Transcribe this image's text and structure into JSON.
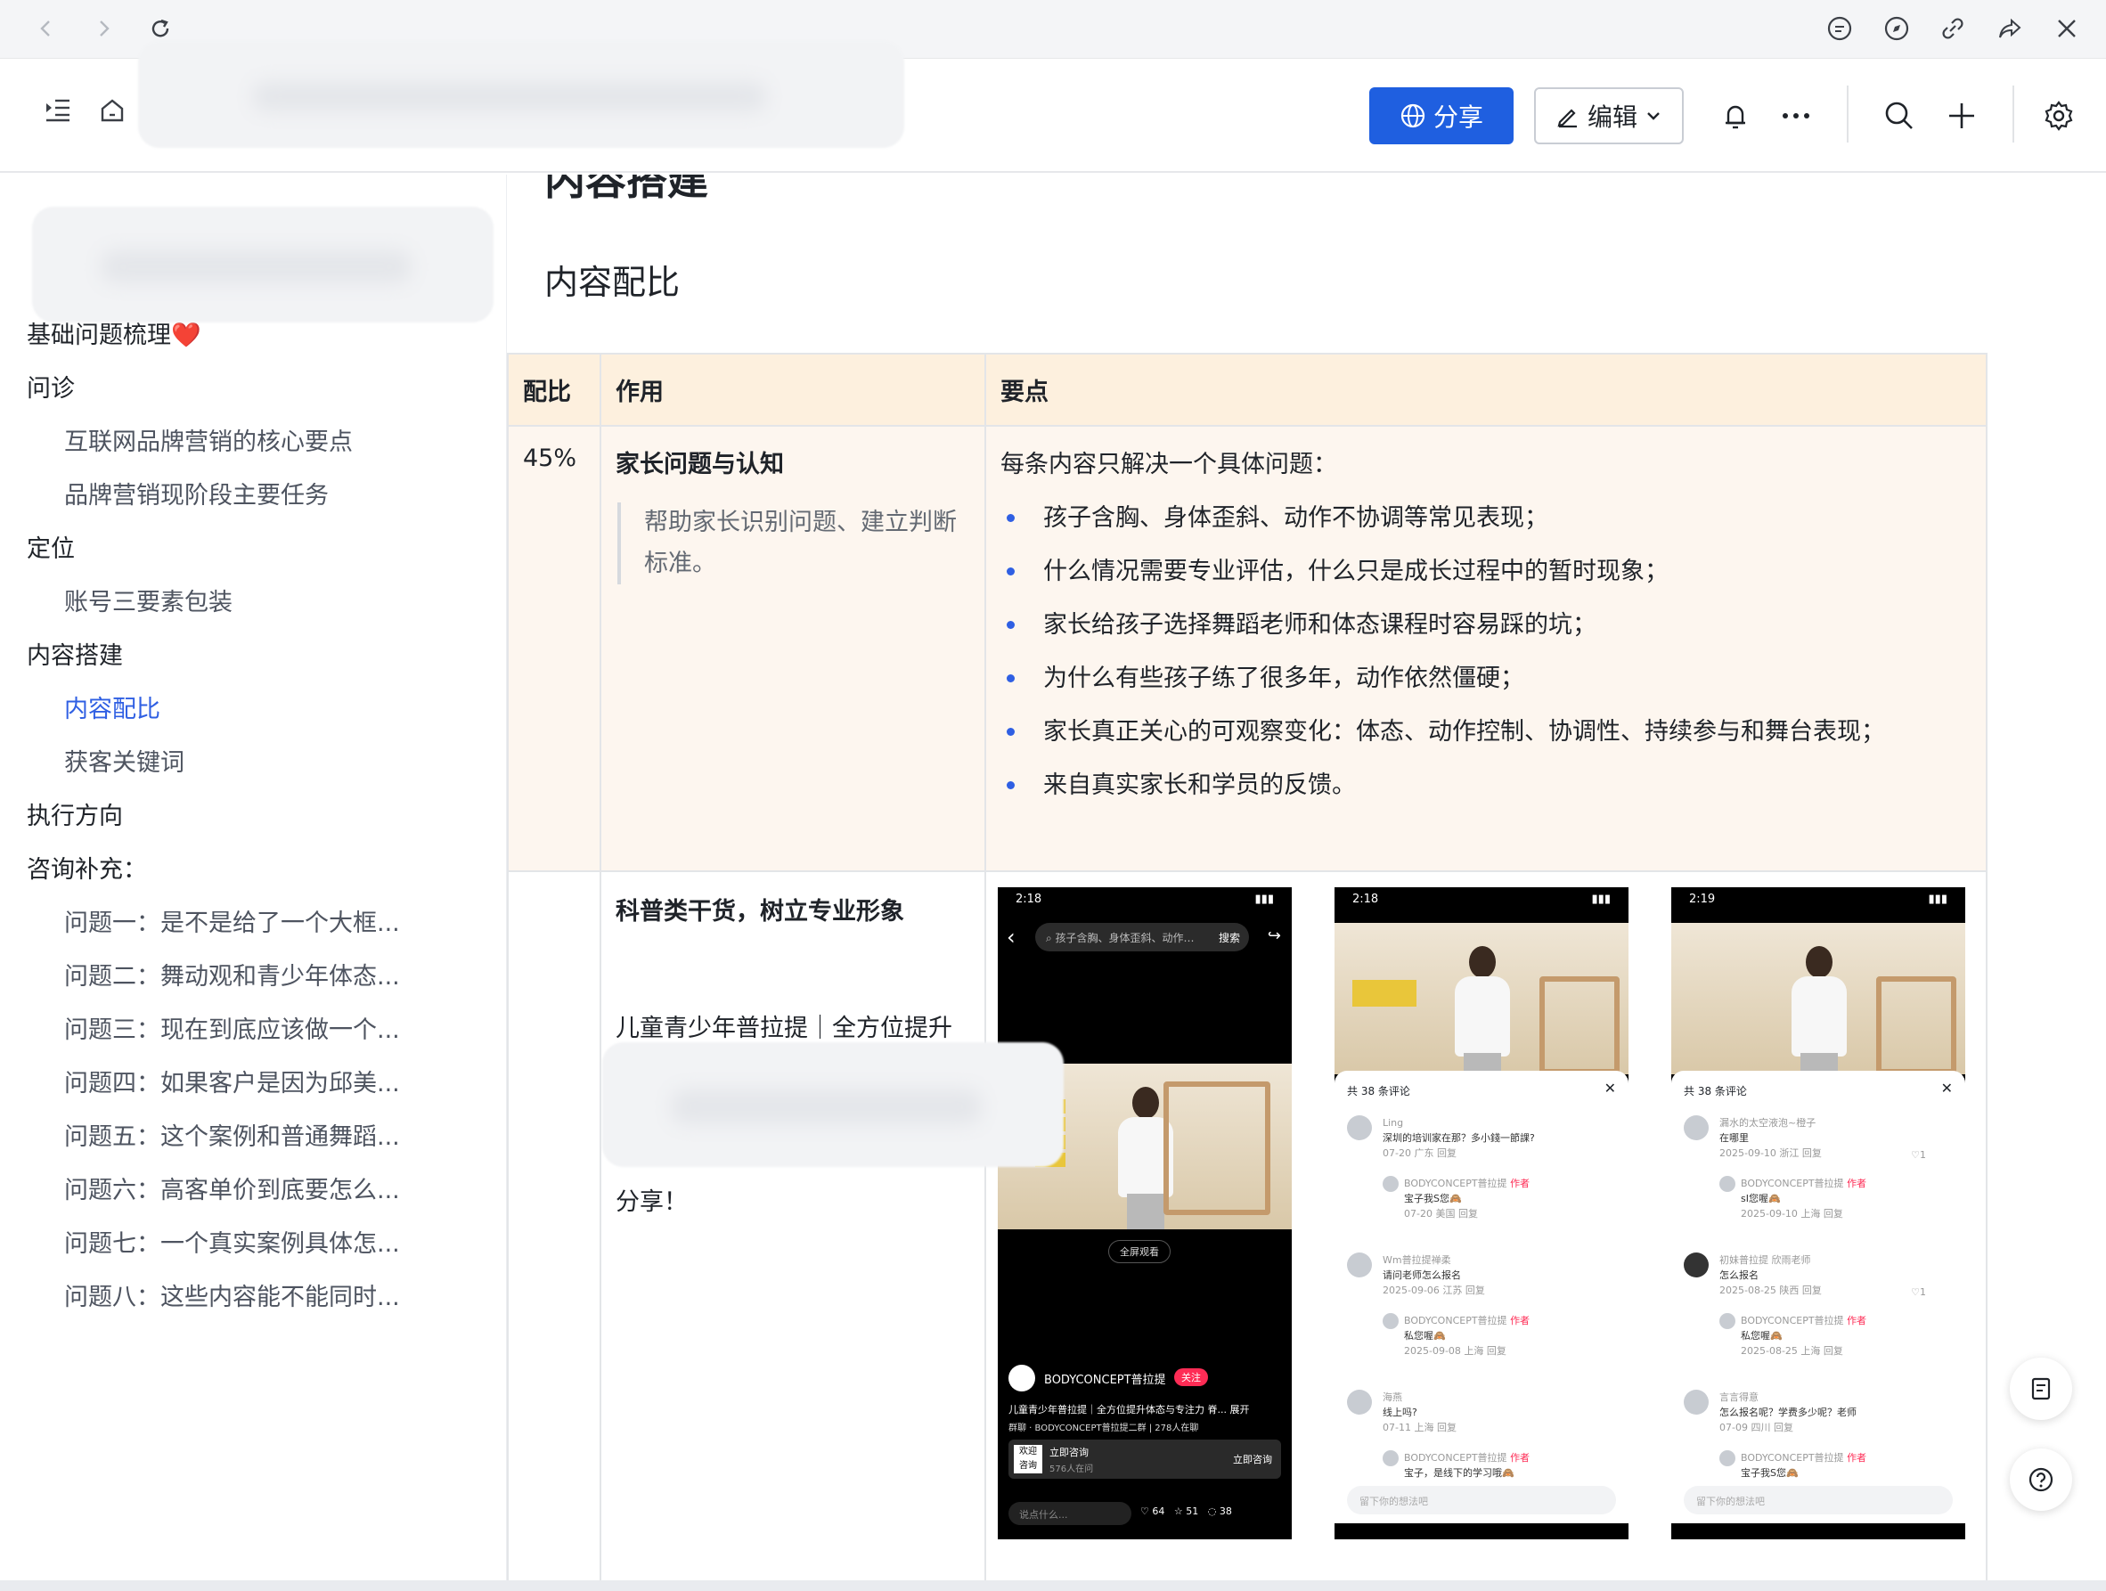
{
  "nav": {
    "icons": [
      "back-icon",
      "forward-icon",
      "reload-icon",
      "comment-icon",
      "compass-icon",
      "link-icon",
      "share-arrow-icon",
      "close-icon"
    ]
  },
  "header": {
    "share_label": "分享",
    "edit_label": "编辑"
  },
  "sidebar": {
    "items": [
      {
        "label": "基础问题梳理❤️",
        "level": 1
      },
      {
        "label": "问诊",
        "level": 1
      },
      {
        "label": "互联网品牌营销的核心要点",
        "level": 2
      },
      {
        "label": "品牌营销现阶段主要任务",
        "level": 2
      },
      {
        "label": "定位",
        "level": 1
      },
      {
        "label": "账号三要素包装",
        "level": 2
      },
      {
        "label": "内容搭建",
        "level": 1
      },
      {
        "label": "内容配比",
        "level": 2,
        "active": true
      },
      {
        "label": "获客关键词",
        "level": 2
      },
      {
        "label": "执行方向",
        "level": 1
      },
      {
        "label": "咨询补充：",
        "level": 1
      },
      {
        "label": "问题一：是不是给了一个大框...",
        "level": 2
      },
      {
        "label": "问题二：舞动观和青少年体态...",
        "level": 2
      },
      {
        "label": "问题三：现在到底应该做一个...",
        "level": 2
      },
      {
        "label": "问题四：如果客户是因为邱美...",
        "level": 2
      },
      {
        "label": "问题五：这个案例和普通舞蹈...",
        "level": 2
      },
      {
        "label": "问题六：高客单价到底要怎么...",
        "level": 2
      },
      {
        "label": "问题七：一个真实案例具体怎...",
        "level": 2
      },
      {
        "label": "问题八：这些内容能不能同时...",
        "level": 2
      }
    ]
  },
  "doc": {
    "h1": "内容搭建",
    "h2": "内容配比",
    "table": {
      "headers": [
        "配比",
        "作用",
        "要点"
      ],
      "row1": {
        "ratio": "45%",
        "role_title": "家长问题与认知",
        "role_quote": "帮助家长识别问题、建立判断标准。",
        "points_intro": "每条内容只解决一个具体问题：",
        "points": [
          "孩子含胸、身体歪斜、动作不协调等常见表现；",
          "什么情况需要专业评估，什么只是成长过程中的暂时现象；",
          "家长给孩子选择舞蹈老师和体态课程时容易踩的坑；",
          "为什么有些孩子练了很多年，动作依然僵硬；",
          "家长真正关心的可观察变化：体态、动作控制、协调性、持续参与和舞台表现；",
          "来自真实家长和学员的反馈。"
        ]
      },
      "row2": {
        "role_title": "科普类干货，树立专业形象",
        "role_line": "儿童青少年普拉提｜全方位提升",
        "role_tail": "分享！"
      }
    }
  },
  "phones": [
    {
      "time": "2:18",
      "search": "孩子含胸、身体歪斜、动作…",
      "search_btn": "搜索",
      "fullscreen": "全屏观看",
      "account": "BODYCONCEPT普拉提",
      "follow": "关注",
      "caption": "儿童青少年普拉提｜全方位提升体态与专注力 脊... 展开",
      "group": "群聊 · BODYCONCEPT普拉提二群 | 278人在聊",
      "consult_title": "立即咨询",
      "consult_sub": "576人在问",
      "consult_btn": "立即咨询",
      "comment_placeholder": "说点什么...",
      "likes": "64",
      "stars": "51",
      "comments": "38",
      "tags": [
        "欢迎",
        "咨询"
      ]
    },
    {
      "time": "2:18",
      "comment_count": "共 38 条评论",
      "input_placeholder": "留下你的想法吧",
      "comments": [
        {
          "user": "Ling",
          "text": "深圳的培训家在那？多小錢一節課?",
          "meta": "07-20 广东  回复"
        },
        {
          "user": "BODYCONCEPT普拉提",
          "badge": "作者",
          "text": "宝子我S您🙈",
          "meta": "07-20 美国  回复"
        },
        {
          "user": "Wm普拉提禅柔",
          "text": "请问老师怎么报名",
          "meta": "2025-09-06 江苏  回复"
        },
        {
          "user": "BODYCONCEPT普拉提",
          "badge": "作者",
          "text": "私您喔🙈",
          "meta": "2025-09-08 上海  回复"
        },
        {
          "user": "海燕",
          "text": "线上吗?",
          "meta": "07-11 上海  回复"
        },
        {
          "user": "BODYCONCEPT普拉提",
          "badge": "作者",
          "text": "宝子，是线下的学习哦🙈",
          "meta": ""
        }
      ]
    },
    {
      "time": "2:19",
      "comment_count": "共 38 条评论",
      "input_placeholder": "留下你的想法吧",
      "comments": [
        {
          "user": "漏水的太空液泡~橙子",
          "text": "在哪里",
          "meta": "2025-09-10 浙江  回复",
          "likes": "1"
        },
        {
          "user": "BODYCONCEPT普拉提",
          "badge": "作者",
          "text": "sI您喔🙈",
          "meta": "2025-09-10 上海  回复"
        },
        {
          "user": "初妹普拉提 欣雨老师",
          "text": "怎么报名",
          "meta": "2025-08-25 陕西  回复",
          "likes": "1"
        },
        {
          "user": "BODYCONCEPT普拉提",
          "badge": "作者",
          "text": "私您喔🙈",
          "meta": "2025-08-25 上海  回复"
        },
        {
          "user": "言言得意",
          "text": "怎么报名呢？学费多少呢？老师",
          "meta": "07-09 四川  回复"
        },
        {
          "user": "BODYCONCEPT普拉提",
          "badge": "作者",
          "text": "宝子我S您🙈",
          "meta": ""
        }
      ]
    }
  ],
  "colors": {
    "accent": "#1f5fe0",
    "table_header": "#fdf0de",
    "row_bg": "#fdf6ef",
    "bullet": "#2f5fe3",
    "follow": "#fe2c55"
  }
}
